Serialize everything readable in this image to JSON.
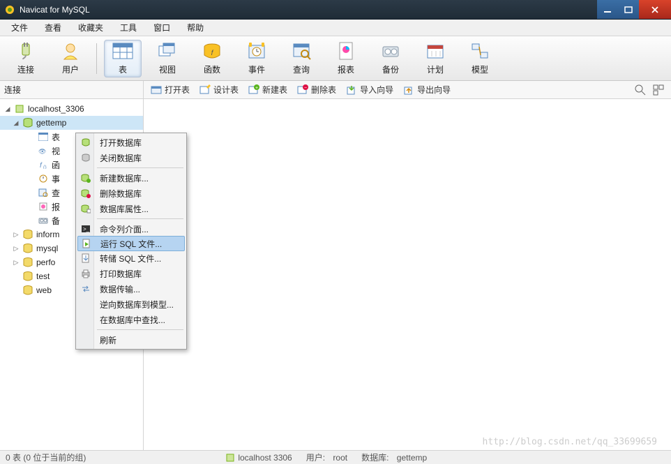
{
  "window": {
    "title": "Navicat for MySQL"
  },
  "menubar": [
    "文件",
    "查看",
    "收藏夹",
    "工具",
    "窗口",
    "帮助"
  ],
  "toolbar": {
    "items": [
      {
        "id": "connect",
        "label": "连接"
      },
      {
        "id": "user",
        "label": "用户"
      },
      {
        "id": "table",
        "label": "表"
      },
      {
        "id": "view",
        "label": "视图"
      },
      {
        "id": "func",
        "label": "函数"
      },
      {
        "id": "event",
        "label": "事件"
      },
      {
        "id": "query",
        "label": "查询"
      },
      {
        "id": "report",
        "label": "报表"
      },
      {
        "id": "backup",
        "label": "备份"
      },
      {
        "id": "plan",
        "label": "计划"
      },
      {
        "id": "model",
        "label": "模型"
      }
    ],
    "selected_index": 2
  },
  "subtoolbar": {
    "connection_label": "连接",
    "actions": {
      "open_table": "打开表",
      "design_table": "设计表",
      "new_table": "新建表",
      "delete_table": "删除表",
      "import_wizard": "导入向导",
      "export_wizard": "导出向导"
    }
  },
  "tree": {
    "root": {
      "label": "localhost_3306"
    },
    "selected_db": {
      "label": "gettemp"
    },
    "db_children": [
      {
        "icon": "table",
        "label": "表"
      },
      {
        "icon": "view",
        "label": "视"
      },
      {
        "icon": "func",
        "label": "函"
      },
      {
        "icon": "event",
        "label": "事"
      },
      {
        "icon": "query",
        "label": "查"
      },
      {
        "icon": "report",
        "label": "报"
      },
      {
        "icon": "backup",
        "label": "备"
      }
    ],
    "other_dbs": [
      {
        "label": "inform"
      },
      {
        "label": "mysql"
      },
      {
        "label": "perfo"
      },
      {
        "label": "test"
      },
      {
        "label": "web"
      }
    ]
  },
  "context_menu": {
    "items": [
      {
        "label": "打开数据库",
        "icon": "db-open"
      },
      {
        "label": "关闭数据库",
        "icon": "db-close"
      },
      {
        "sep": true
      },
      {
        "label": "新建数据库...",
        "icon": "db-new"
      },
      {
        "label": "删除数据库",
        "icon": "db-delete"
      },
      {
        "label": "数据库属性...",
        "icon": "db-props"
      },
      {
        "sep": true
      },
      {
        "label": "命令列介面...",
        "icon": "cmd"
      },
      {
        "label": "运行 SQL 文件...",
        "icon": "run-sql",
        "highlight": true
      },
      {
        "label": "转储 SQL 文件...",
        "icon": "dump-sql"
      },
      {
        "label": "打印数据库",
        "icon": "print"
      },
      {
        "label": "数据传输...",
        "icon": "transfer"
      },
      {
        "label": "逆向数据库到模型..."
      },
      {
        "label": "在数据库中查找..."
      },
      {
        "sep": true
      },
      {
        "label": "刷新"
      }
    ]
  },
  "statusbar": {
    "left": "0 表 (0 位于当前的组)",
    "server": "localhost 3306",
    "user_label": "用户:",
    "user_value": "root",
    "db_label": "数据库:",
    "db_value": "gettemp"
  },
  "watermark": "http://blog.csdn.net/qq_33699659"
}
